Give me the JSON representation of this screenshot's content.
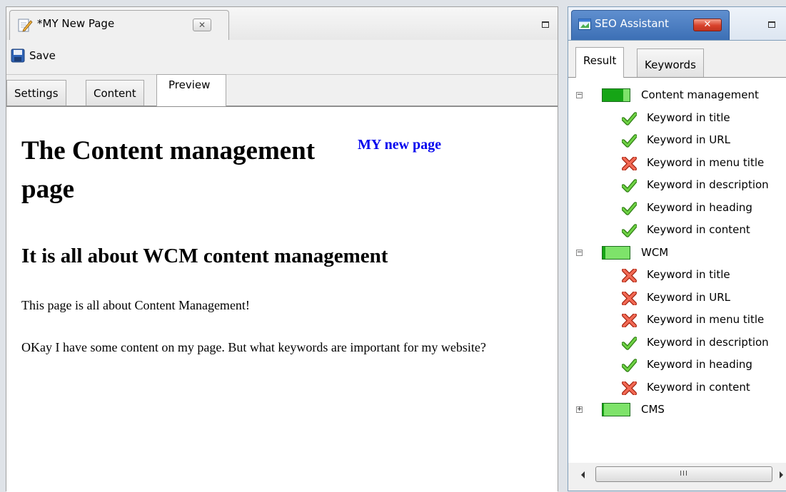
{
  "editor": {
    "tab_title": "*MY New Page",
    "close_glyph": "✕",
    "toolbar": {
      "save_label": "Save"
    },
    "subtabs": [
      {
        "label": "Settings"
      },
      {
        "label": "Content"
      },
      {
        "label": "Preview",
        "active": true
      }
    ],
    "preview": {
      "link_text": "MY new page",
      "h1": "The Content management page",
      "h2": "It is all about WCM content management",
      "paragraphs": [
        "This page is all about Content Management!",
        "OKay I have some content on my page. But what keywords are important for my website?"
      ]
    }
  },
  "seo": {
    "panel_title": "SEO Assistant",
    "close_glyph": "✕",
    "tabs": [
      {
        "label": "Result",
        "active": true
      },
      {
        "label": "Keywords"
      }
    ],
    "keywords": [
      {
        "name": "Content management",
        "expanded": true,
        "score": 0.75,
        "checks": [
          {
            "label": "Keyword in title",
            "ok": true
          },
          {
            "label": "Keyword in URL",
            "ok": true
          },
          {
            "label": "Keyword in menu title",
            "ok": false
          },
          {
            "label": "Keyword in description",
            "ok": true
          },
          {
            "label": "Keyword in heading",
            "ok": true
          },
          {
            "label": "Keyword in content",
            "ok": true
          }
        ]
      },
      {
        "name": "WCM",
        "expanded": true,
        "score": 0.1,
        "checks": [
          {
            "label": "Keyword in title",
            "ok": false
          },
          {
            "label": "Keyword in URL",
            "ok": false
          },
          {
            "label": "Keyword in menu title",
            "ok": false
          },
          {
            "label": "Keyword in description",
            "ok": true
          },
          {
            "label": "Keyword in heading",
            "ok": true
          },
          {
            "label": "Keyword in content",
            "ok": false
          }
        ]
      },
      {
        "name": "CMS",
        "expanded": false,
        "score": 0.05,
        "checks": []
      }
    ],
    "scrollbar_grip": "III",
    "colors": {
      "score_fill": "#16a516",
      "score_bg": "#7ee36a",
      "ok": "#3aa81d",
      "fail": "#d9432b"
    }
  }
}
